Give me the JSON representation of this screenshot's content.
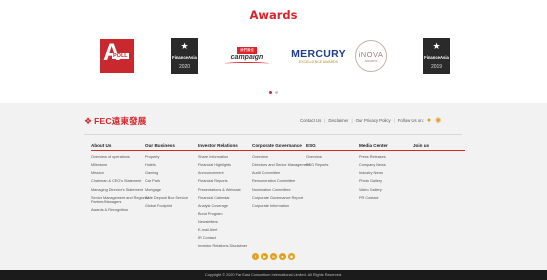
{
  "awards": {
    "title": "Awards",
    "items": [
      {
        "kind": "apoll",
        "big": "A",
        "name": "POLL",
        "icon": "asiamoney-poll-logo"
      },
      {
        "kind": "financeasia",
        "name": "FinanceAsia",
        "year": "2020",
        "icon": "star-icon"
      },
      {
        "kind": "campco",
        "tag": "我們最佳",
        "name": "campaign",
        "icon": "campaign-logo"
      },
      {
        "kind": "mercury",
        "name": "MERCURY",
        "sub": "EXCELLENCE AWARDS",
        "icon": "mercury-logo"
      },
      {
        "kind": "inova",
        "name": "iNOVA",
        "sub": "AWARDS",
        "icon": "inova-logo"
      },
      {
        "kind": "financeasia",
        "name": "FinanceAsia",
        "year": "2019",
        "icon": "star-icon"
      }
    ],
    "carousel_dots": 2,
    "active_dot": 0
  },
  "footer": {
    "logo_text": "FEC遠東發展",
    "toplinks": {
      "contact": "Contact Us",
      "disclaimer": "Disclaimer",
      "privacy": "Our Privacy Policy",
      "follow": "Follow Us on:"
    },
    "columns": [
      {
        "title": "About Us",
        "items": [
          "Overview of operations",
          "Milestone",
          "Mission",
          "Chairman & CEO's Statement",
          "Managing Director's Statement",
          "Senior Management and Regional Partner/Managers",
          "Awards & Recognition"
        ]
      },
      {
        "title": "Our Business",
        "items": [
          "Property",
          "Hotels",
          "Gaming",
          "Car Park",
          "Mortgage",
          "Safe Deposit Box Service",
          "Global Footprint"
        ]
      },
      {
        "title": "Investor Relations",
        "items": [
          "Share Information",
          "Financial Highlights",
          "Announcement",
          "Financial Reports",
          "Presentations & Webcast",
          "Financial Calendar",
          "Analyst Coverage",
          "Bond Program",
          "Newsletters",
          "E-mail Alert",
          "IR Contact",
          "Investor Relations Disclaimer"
        ]
      },
      {
        "title": "Corporate Governance",
        "items": [
          "Overview",
          "Directors and Senior Management",
          "Audit Committee",
          "Remuneration Committee",
          "Nomination Committee",
          "Corporate Governance Report",
          "Corporate Information"
        ]
      },
      {
        "title": "ESG",
        "items": [
          "Overview",
          "ESG Reports"
        ]
      },
      {
        "title": "Media Center",
        "items": [
          "Press Releases",
          "Company News",
          "Industry News",
          "Photo Gallery",
          "Video Gallery",
          "PR Contact"
        ]
      },
      {
        "title": "Join us",
        "items": []
      }
    ],
    "social_icons": [
      "facebook-icon",
      "youtube-icon",
      "linkedin-icon",
      "wechat-icon",
      "weibo-icon"
    ],
    "copyright": "Copyright © 2020 Far East Consortium International Limited. All Rights Reserved."
  },
  "colors": {
    "accent": "#d7262b",
    "social": "#e0a21f",
    "footer_bg": "#f2f2f2",
    "copyright_bg": "#1b1b1b"
  }
}
